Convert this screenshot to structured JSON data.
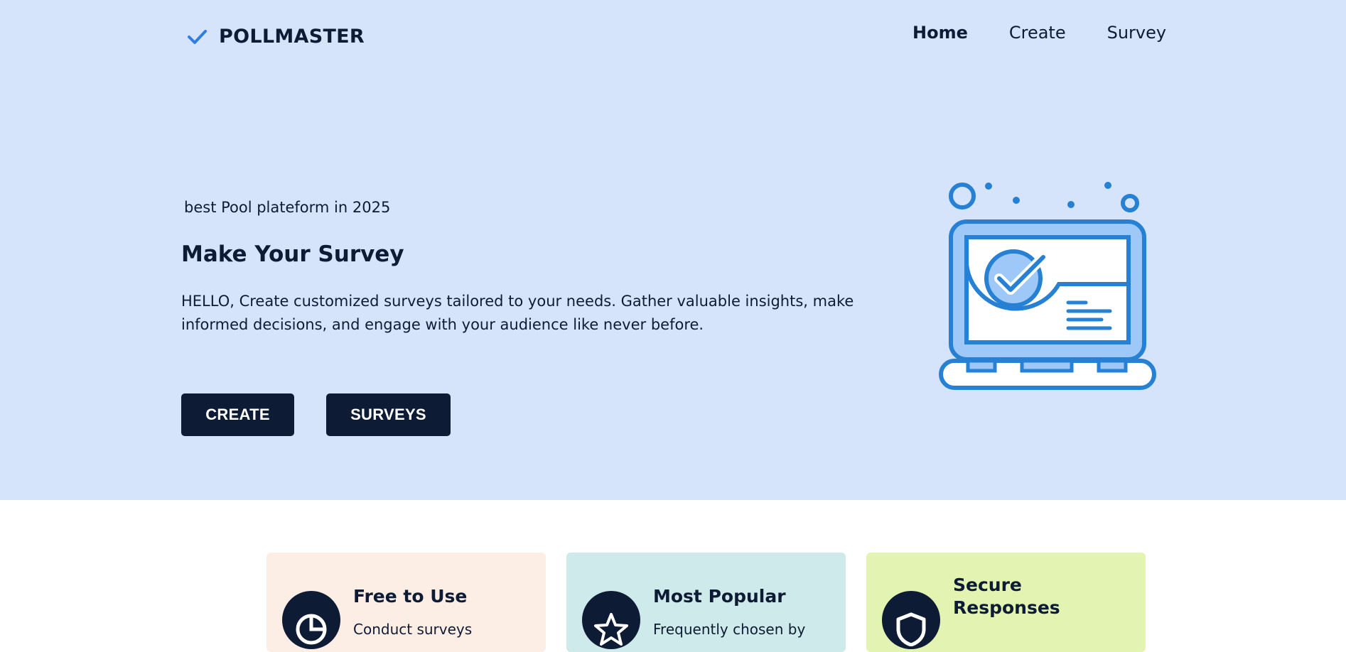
{
  "brand": {
    "name": "POLLMASTER",
    "icon": "check-icon",
    "color": "#2f7fe0"
  },
  "nav": {
    "items": [
      "Home",
      "Create",
      "Survey"
    ],
    "active": "Home"
  },
  "hero": {
    "tagline": "best Pool plateform in 2025",
    "headline": "Make Your Survey",
    "description": "HELLO, Create customized surveys tailored to your needs. Gather valuable insights, make informed decisions, and engage with your audience like never before.",
    "buttons": {
      "create": "CREATE",
      "surveys": "SURVEYS"
    },
    "illustration": "laptop-checkmark-icon"
  },
  "features": [
    {
      "title": "Free to Use",
      "text": "Conduct surveys",
      "icon": "pie-chart-icon",
      "bg": "#fdeee5"
    },
    {
      "title": "Most Popular",
      "text": "Frequently chosen by",
      "icon": "star-icon",
      "bg": "#cfeaea"
    },
    {
      "title": "Secure Responses",
      "text": "",
      "icon": "shield-icon",
      "bg": "#e3f3b1"
    }
  ],
  "colors": {
    "hero_bg": "#d5e4fb",
    "dark": "#0d1b34",
    "accent": "#2f7fe0",
    "illustration_blue": "#2680d4",
    "illustration_light": "#9ec8f8"
  }
}
